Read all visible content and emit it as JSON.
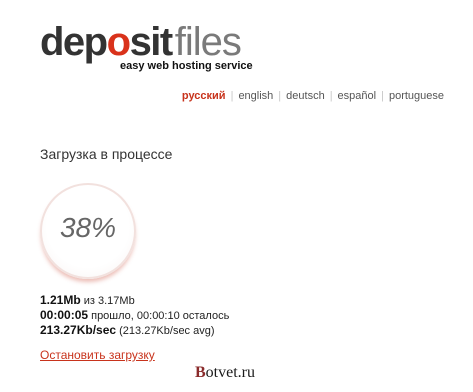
{
  "logo": {
    "deposit_pre": "dep",
    "deposit_o": "o",
    "deposit_post": "sit",
    "files": "files",
    "tagline": "easy web hosting service"
  },
  "languages": [
    "русский",
    "english",
    "deutsch",
    "español",
    "portuguese"
  ],
  "active_language": "русский",
  "title": "Загрузка в процессе",
  "progress": {
    "percent_label": "38%",
    "value": 0.38
  },
  "stats": {
    "downloaded": "1.21Mb",
    "of_text": "из 3.17Mb",
    "elapsed": "00:00:05",
    "elapsed_text": "прошло, 00:00:10 осталось",
    "speed": "213.27Kb/sec",
    "speed_text": "(213.27Kb/sec avg)"
  },
  "stop_link": "Остановить загрузку",
  "watermark": {
    "first": "B",
    "rest": "otvet.ru"
  },
  "colors": {
    "accent": "#c8331c",
    "logo_dark": "#333333",
    "logo_gray": "#7a7a7a"
  }
}
